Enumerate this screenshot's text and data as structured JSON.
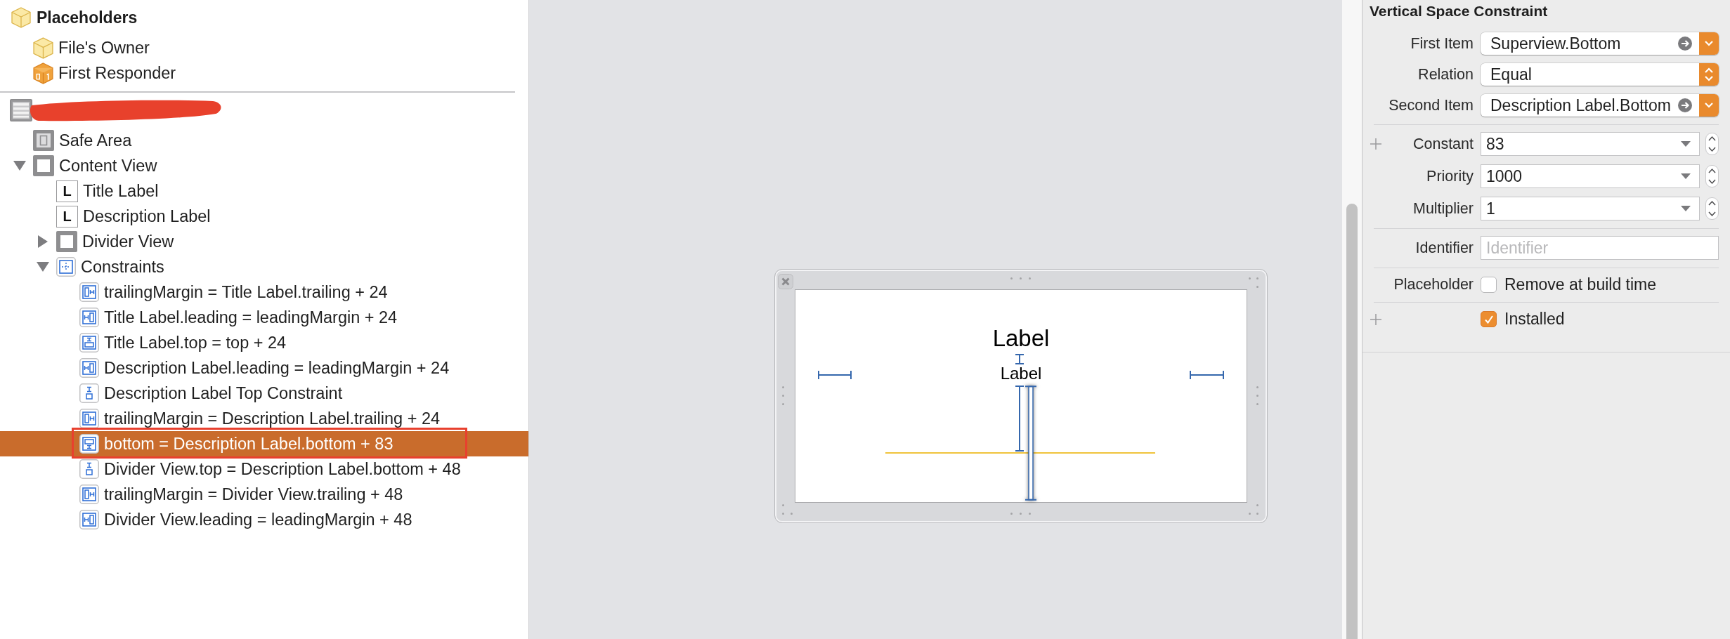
{
  "outline": {
    "placeholders": {
      "title": "Placeholders",
      "items": [
        {
          "kind": "cube",
          "label": "File's Owner",
          "selected": false
        },
        {
          "kind": "responder",
          "label": "First Responder",
          "selected": false
        }
      ]
    },
    "tree": [
      {
        "kind": "cell",
        "redacted": true,
        "selected": false,
        "children": [
          {
            "kind": "safe-area",
            "label": "Safe Area",
            "selected": false
          },
          {
            "kind": "view",
            "label": "Content View",
            "expanded": true,
            "selected": false,
            "children": [
              {
                "kind": "label",
                "glyph": "L",
                "label": "Title Label",
                "selected": false
              },
              {
                "kind": "label",
                "glyph": "L",
                "label": "Description Label",
                "selected": false
              },
              {
                "kind": "view",
                "label": "Divider View",
                "expanded": false,
                "selected": false
              },
              {
                "kind": "constraints",
                "label": "Constraints",
                "expanded": true,
                "selected": false,
                "children": [
                  {
                    "kind": "trailing",
                    "label": "trailingMargin = Title Label.trailing + 24",
                    "selected": false,
                    "annotated": false
                  },
                  {
                    "kind": "leading",
                    "label": "Title Label.leading = leadingMargin + 24",
                    "selected": false,
                    "annotated": false
                  },
                  {
                    "kind": "top",
                    "label": "Title Label.top = top + 24",
                    "selected": false,
                    "annotated": false
                  },
                  {
                    "kind": "leading",
                    "label": "Description Label.leading = leadingMargin + 24",
                    "selected": false,
                    "annotated": false
                  },
                  {
                    "kind": "spacing",
                    "label": "Description Label Top Constraint",
                    "selected": false,
                    "annotated": false
                  },
                  {
                    "kind": "trailing",
                    "label": "trailingMargin = Description Label.trailing + 24",
                    "selected": false,
                    "annotated": false
                  },
                  {
                    "kind": "bottom",
                    "label": "bottom = Description Label.bottom + 83",
                    "selected": true,
                    "annotated": true
                  },
                  {
                    "kind": "spacing",
                    "label": "Divider View.top = Description Label.bottom + 48",
                    "selected": false,
                    "annotated": false
                  },
                  {
                    "kind": "trailing",
                    "label": "trailingMargin = Divider View.trailing + 48",
                    "selected": false,
                    "annotated": false
                  },
                  {
                    "kind": "leading",
                    "label": "Divider View.leading = leadingMargin + 48",
                    "selected": false,
                    "annotated": false
                  }
                ]
              }
            ]
          }
        ]
      }
    ]
  },
  "canvas": {
    "title_label": "Label",
    "description_label": "Label",
    "markers": [
      {
        "kind": "leading",
        "selected": false
      },
      {
        "kind": "trailing",
        "selected": false
      },
      {
        "kind": "label-gap",
        "selected": false
      },
      {
        "kind": "divider-gap",
        "selected": false
      },
      {
        "kind": "bottom-gap",
        "selected": true
      }
    ]
  },
  "inspector": {
    "title": "Vertical Space Constraint",
    "sections": [
      {
        "rows": [
          {
            "kind": "item-popup",
            "label": "First Item",
            "value": "Superview.Bottom",
            "variations": false
          },
          {
            "kind": "popup",
            "label": "Relation",
            "value": "Equal",
            "variations": false
          },
          {
            "kind": "item-popup",
            "label": "Second Item",
            "value": "Description Label.Bottom",
            "variations": false
          }
        ]
      },
      {
        "rows": [
          {
            "kind": "number",
            "label": "Constant",
            "value": "83",
            "variations": true
          },
          {
            "kind": "number",
            "label": "Priority",
            "value": "1000",
            "variations": false
          },
          {
            "kind": "number",
            "label": "Multiplier",
            "value": "1",
            "variations": false
          }
        ]
      },
      {
        "rows": [
          {
            "kind": "text",
            "label": "Identifier",
            "placeholder": "Identifier",
            "variations": false
          }
        ]
      },
      {
        "rows": [
          {
            "kind": "checkbox",
            "label": "Placeholder",
            "text": "Remove at build time",
            "checked": false,
            "variations": false
          }
        ]
      },
      {
        "rows": [
          {
            "kind": "checkbox",
            "text": "Installed",
            "checked": true,
            "variations": true
          }
        ]
      }
    ]
  }
}
